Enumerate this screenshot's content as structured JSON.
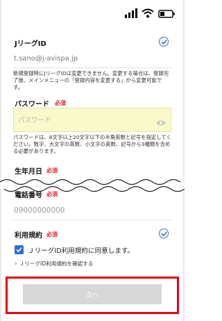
{
  "jleague_id": {
    "label": "JリーグID",
    "value": "t.sano@j-avispa.jp",
    "note": "新規登録時にJリーグIDは変更できません。変更する場合は、登録完了後、メインメニューの「登録内容を変更する」から変更可能です。"
  },
  "password": {
    "label": "パスワード",
    "required": "必須",
    "placeholder": "パスワード",
    "note": "パスワードは、8文字以上20文字以下の半角英数と記号を指定してください。数字、大文字の英数、小文字の英数、記号から3種類を含める必要があります。"
  },
  "birthdate": {
    "label": "生年月日",
    "required": "必須"
  },
  "phone": {
    "label": "電話番号",
    "required": "必須",
    "value": "09000000000"
  },
  "terms": {
    "label": "利用規約",
    "required": "必須",
    "checkbox_label": "ＪリーグID利用規約に同意します。",
    "link_text": "ＪリーグID利用規約を確認する"
  },
  "next_button": {
    "label": "次へ"
  },
  "icons": {
    "check": "check-circle-icon",
    "eye": "eye-icon",
    "signal": "signal-icon",
    "wifi": "wifi-icon",
    "battery": "battery-icon"
  },
  "colors": {
    "accent": "#2d6fd1",
    "required": "#e21e24",
    "highlight": "#e60012",
    "password_bg": "#f9f9c9",
    "button_disabled": "#d7d7d7"
  }
}
